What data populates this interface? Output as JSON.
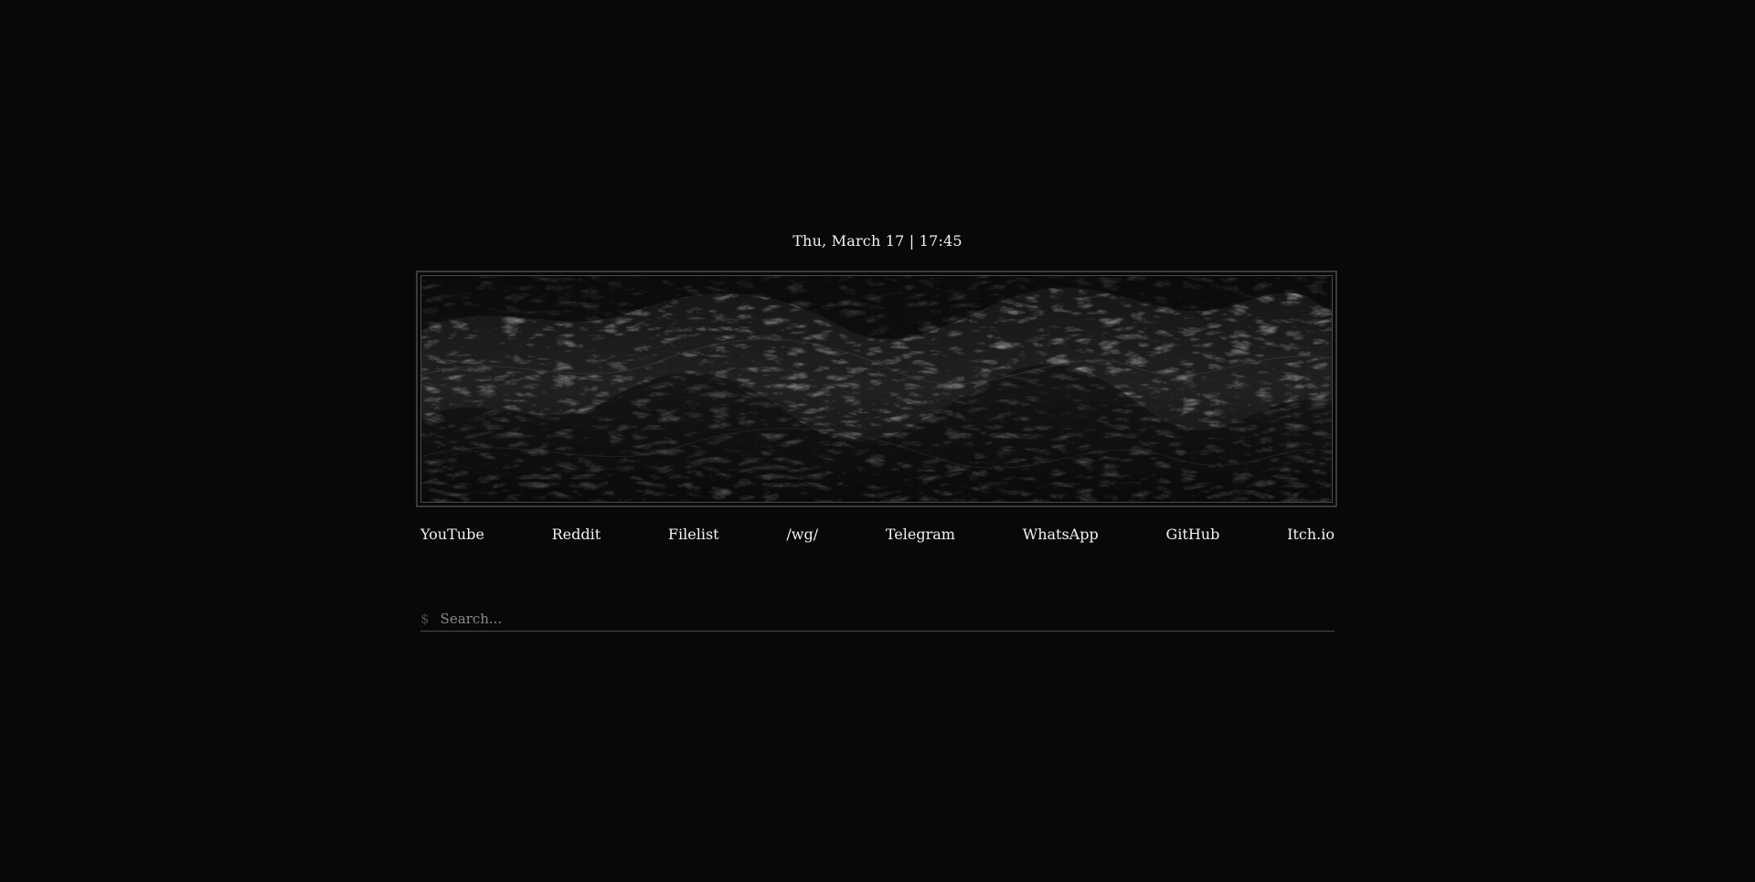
{
  "datetime": "Thu, March 17 | 17:45",
  "banner": {
    "description_icon": "dark-ocean-waves-image"
  },
  "links": [
    {
      "label": "YouTube"
    },
    {
      "label": "Reddit"
    },
    {
      "label": "Filelist"
    },
    {
      "label": "/wg/"
    },
    {
      "label": "Telegram"
    },
    {
      "label": "WhatsApp"
    },
    {
      "label": "GitHub"
    },
    {
      "label": "Itch.io"
    }
  ],
  "search": {
    "prompt": "$",
    "placeholder": "Search..."
  },
  "colors": {
    "background": "#080808",
    "text": "#f2f2f2",
    "border": "#3a3a3a",
    "muted": "#4a4a4a"
  }
}
